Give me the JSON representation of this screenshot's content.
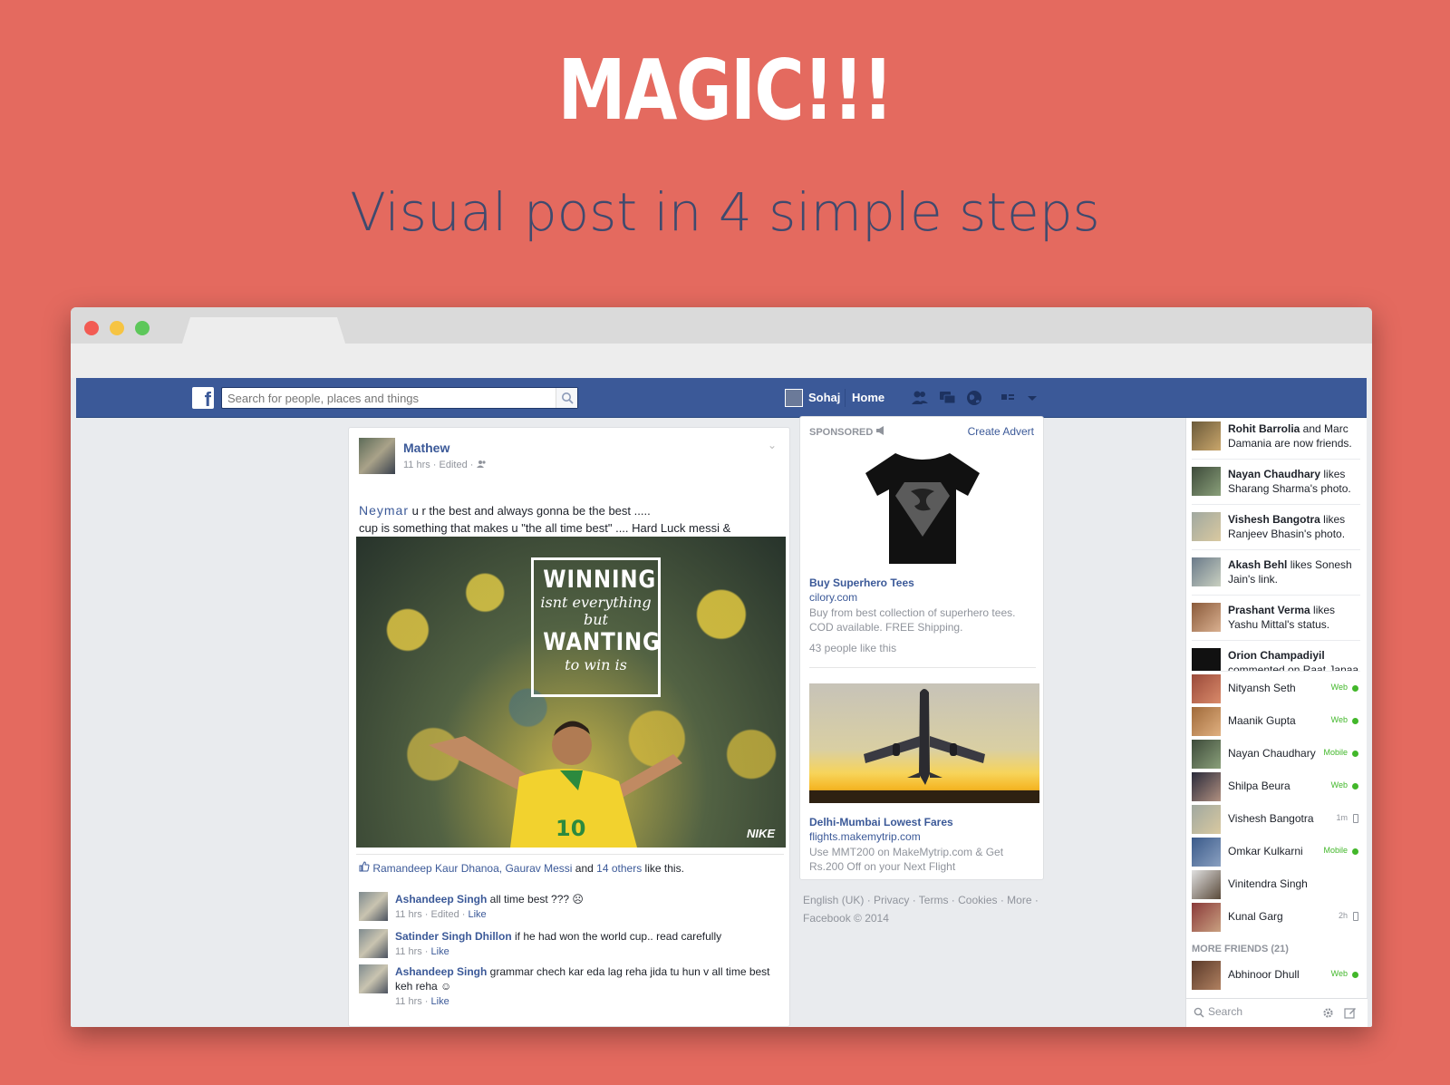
{
  "hero": {
    "title": "MAGIC!!!",
    "subtitle": "Visual post in 4 simple steps"
  },
  "topbar": {
    "search_placeholder": "Search for people, places and things",
    "user_name": "Sohaj",
    "home_label": "Home"
  },
  "post": {
    "author": "Mathew",
    "meta": "11 hrs · Edited · ",
    "text_mention": "Neymar",
    "text_line1": " u r the best and always gonna be the best .....",
    "text_line2": "cup is something that makes u \"the all time best\" .... Hard Luck messi &",
    "image_quote": {
      "line1": "WINNING",
      "line2": "isnt everything",
      "line3": "but",
      "line4": "WANTING",
      "line5": "to win is"
    },
    "image_brand": "NIKE",
    "likes_names": "Ramandeep Kaur Dhanoa, Gaurav Messi",
    "likes_and": " and ",
    "likes_others": "14 others",
    "likes_suffix": " like this.",
    "comments": [
      {
        "name": "Ashandeep Singh",
        "text": " all time best ??? ☹",
        "meta": "11 hrs · Edited · ",
        "action": "Like"
      },
      {
        "name": "Satinder Singh Dhillon",
        "text": " if he had won the world cup.. read carefully",
        "meta": "11 hrs · ",
        "action": "Like"
      },
      {
        "name": "Ashandeep Singh",
        "text": " grammar chech kar eda lag reha jida tu hun v all time best keh reha ☺",
        "meta": "11 hrs · ",
        "action": "Like"
      }
    ]
  },
  "ads": {
    "sponsored_label": "SPONSORED",
    "create_advert": "Create Advert",
    "ad1": {
      "title": "Buy Superhero Tees",
      "url": "cilory.com",
      "desc": "Buy from best collection of superhero tees. COD available. FREE Shipping.",
      "likes": "43 people like this"
    },
    "ad2": {
      "title": "Delhi-Mumbai Lowest Fares",
      "url": "flights.makemytrip.com",
      "desc": "Use MMT200 on MakeMytrip.com & Get Rs.200 Off on your Next Flight"
    },
    "footer": "English (UK) · Privacy · Terms · Cookies · More · Facebook © 2014"
  },
  "ticker": [
    {
      "bold": "Rohit Barrolia",
      "text": " and Marc Damania are now friends."
    },
    {
      "bold": "Nayan Chaudhary",
      "text": " likes Sharang Sharma's photo."
    },
    {
      "bold": "Vishesh Bangotra",
      "text": " likes Ranjeev Bhasin's photo."
    },
    {
      "bold": "Akash Behl",
      "text": " likes Sonesh Jain's link."
    },
    {
      "bold": "Prashant Verma",
      "text": " likes Yashu Mittal's status."
    },
    {
      "bold": "Orion Champadiyil",
      "text": " commented on Raat Janaa"
    }
  ],
  "friends": [
    {
      "name": "Nityansh Seth",
      "status": "Web"
    },
    {
      "name": "Maanik Gupta",
      "status": "Web"
    },
    {
      "name": "Nayan Chaudhary",
      "status": "Mobile"
    },
    {
      "name": "Shilpa Beura",
      "status": "Web"
    },
    {
      "name": "Vishesh Bangotra",
      "status": "1m"
    },
    {
      "name": "Omkar Kulkarni",
      "status": "Mobile"
    },
    {
      "name": "Vinitendra Singh",
      "status": ""
    },
    {
      "name": "Kunal Garg",
      "status": "2h"
    }
  ],
  "more_friends_label": "MORE FRIENDS (21)",
  "more_friend": {
    "name": "Abhinoor Dhull",
    "status": "Web"
  },
  "chat_search_placeholder": "Search",
  "colors": {
    "background": "#e46a5f",
    "facebook_blue": "#3b5998",
    "online_green": "#42b72a"
  }
}
